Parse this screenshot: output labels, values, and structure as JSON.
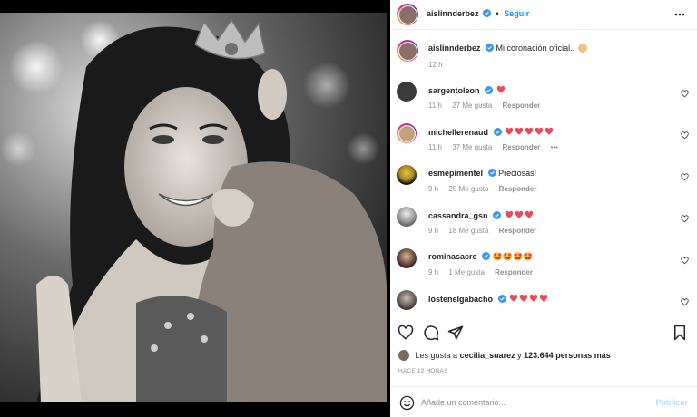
{
  "header": {
    "username": "aislinnderbez",
    "follow_label": "Seguir",
    "separator": "•"
  },
  "caption": {
    "username": "aislinnderbez",
    "text": "Mi coronación oficial..",
    "time": "12 h"
  },
  "comments": [
    {
      "username": "sargentoleon",
      "text": "",
      "hearts": 1,
      "time": "11 h",
      "likes": "27 Me gusta",
      "reply": "Responder",
      "more": ""
    },
    {
      "username": "michellerenaud",
      "text": "",
      "hearts": 5,
      "time": "11 h",
      "likes": "37 Me gusta",
      "reply": "Responder",
      "more": "•••"
    },
    {
      "username": "esmepimentel",
      "text": "Preciosas!",
      "hearts": 0,
      "time": "9 h",
      "likes": "25 Me gusta",
      "reply": "Responder",
      "more": ""
    },
    {
      "username": "cassandra_gsn",
      "text": "",
      "hearts": 3,
      "time": "9 h",
      "likes": "18 Me gusta",
      "reply": "Responder",
      "more": ""
    },
    {
      "username": "rominasacre",
      "text": "🤩🤩🤩🤩",
      "hearts": 0,
      "time": "9 h",
      "likes": "1 Me gusta",
      "reply": "Responder",
      "more": ""
    },
    {
      "username": "lostenelgabacho",
      "text": "",
      "hearts": 4,
      "time": "",
      "likes": "",
      "reply": "",
      "more": ""
    }
  ],
  "likes": {
    "prefix": "Les gusta a",
    "user": "cecilia_suarez",
    "connector": "y",
    "count": "123.644",
    "suffix": "personas más"
  },
  "time_ago": "HACE 12 HORAS",
  "add_comment": {
    "placeholder": "Añade un comentario...",
    "publish_label": "Publicar"
  },
  "colors": {
    "accent": "#0095f6",
    "heart": "#ed4956",
    "verified": "#3897f0",
    "muted": "#8e8e8e"
  },
  "icons": {
    "more": "more-horizontal-icon",
    "verified": "verified-badge-icon",
    "like": "heart-icon",
    "comment": "comment-bubble-icon",
    "share": "paper-plane-icon",
    "save": "bookmark-icon",
    "emoji": "smiley-icon"
  }
}
